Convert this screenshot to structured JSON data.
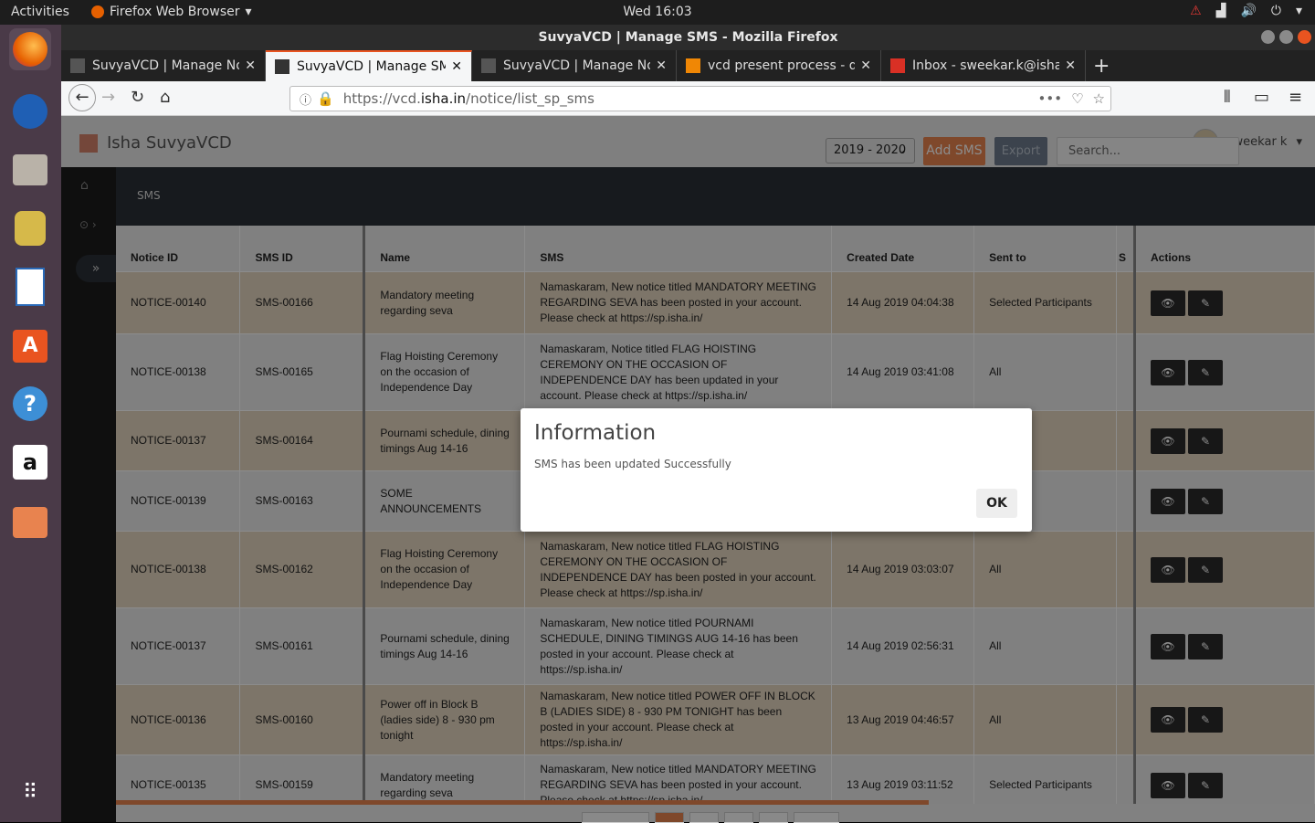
{
  "topbar": {
    "activities": "Activities",
    "app_name": "Firefox Web Browser",
    "clock": "Wed 16:03"
  },
  "window": {
    "title": "SuvyaVCD | Manage SMS - Mozilla Firefox"
  },
  "tabs": [
    {
      "label": "SuvyaVCD | Manage Noti"
    },
    {
      "label": "SuvyaVCD | Manage SMS"
    },
    {
      "label": "SuvyaVCD | Manage Noti"
    },
    {
      "label": "vcd present process - dra"
    },
    {
      "label": "Inbox - sweekar.k@ishaf"
    }
  ],
  "url": {
    "prefix": "https://vcd.",
    "domain": "isha.in",
    "path": "/notice/list_sp_sms"
  },
  "app": {
    "brand": "Isha SuvyaVCD",
    "user": "sweekar k",
    "breadcrumb": "SMS",
    "year": "2019 - 2020",
    "add_sms": "Add SMS",
    "export": "Export",
    "search_placeholder": "Search..."
  },
  "table": {
    "headers": [
      "Notice ID",
      "SMS ID",
      "Name",
      "SMS",
      "Created Date",
      "Sent to",
      "S",
      "Actions"
    ],
    "rows": [
      {
        "notice_id": "NOTICE-00140",
        "sms_id": "SMS-00166",
        "name": "Mandatory meeting regarding seva",
        "sms": "Namaskaram, New notice titled MANDATORY MEETING REGARDING SEVA has been posted in your account. Please check at https://sp.isha.in/",
        "created": "14 Aug 2019 04:04:38",
        "sent_to": "Selected Participants"
      },
      {
        "notice_id": "NOTICE-00138",
        "sms_id": "SMS-00165",
        "name": "Flag Hoisting Ceremony on the occasion of Independence Day",
        "sms": "Namaskaram, Notice titled FLAG HOISTING CEREMONY ON THE OCCASION OF INDEPENDENCE DAY has been updated in your account. Please check at https://sp.isha.in/",
        "created": "14 Aug 2019 03:41:08",
        "sent_to": "All"
      },
      {
        "notice_id": "NOTICE-00137",
        "sms_id": "SMS-00164",
        "name": "Pournami schedule, dining timings Aug 14-16",
        "sms": "",
        "created": "",
        "sent_to": ""
      },
      {
        "notice_id": "NOTICE-00139",
        "sms_id": "SMS-00163",
        "name": "SOME ANNOUNCEMENTS",
        "sms": "",
        "created": "",
        "sent_to": ""
      },
      {
        "notice_id": "NOTICE-00138",
        "sms_id": "SMS-00162",
        "name": "Flag Hoisting Ceremony on the occasion of Independence Day",
        "sms": "Namaskaram, New notice titled FLAG HOISTING CEREMONY ON THE OCCASION OF INDEPENDENCE DAY has been posted in your account. Please check at https://sp.isha.in/",
        "created": "14 Aug 2019 03:03:07",
        "sent_to": "All"
      },
      {
        "notice_id": "NOTICE-00137",
        "sms_id": "SMS-00161",
        "name": "Pournami schedule, dining timings Aug 14-16",
        "sms": "Namaskaram, New notice titled POURNAMI SCHEDULE, DINING TIMINGS AUG 14-16 has been posted in your account. Please check at https://sp.isha.in/",
        "created": "14 Aug 2019 02:56:31",
        "sent_to": "All"
      },
      {
        "notice_id": "NOTICE-00136",
        "sms_id": "SMS-00160",
        "name": "Power off in Block B (ladies side) 8 - 930 pm tonight",
        "sms": "Namaskaram, New notice titled POWER OFF IN BLOCK B (LADIES SIDE) 8 - 930 PM TONIGHT has been posted in your account. Please check at https://sp.isha.in/",
        "created": "13 Aug 2019 04:46:57",
        "sent_to": "All"
      },
      {
        "notice_id": "NOTICE-00135",
        "sms_id": "SMS-00159",
        "name": "Mandatory meeting regarding seva",
        "sms": "Namaskaram, New notice titled MANDATORY MEETING REGARDING SEVA has been posted in your account. Please check at https://sp.isha.in/",
        "created": "13 Aug 2019 03:11:52",
        "sent_to": "Selected Participants"
      }
    ]
  },
  "dialog": {
    "title": "Information",
    "message": "SMS has been updated Successfully",
    "ok": "OK"
  },
  "colors": {
    "accent": "#e8834f",
    "row_odd": "#e4d6c0",
    "row_even": "#e9e9e9",
    "ubuntu_orange": "#e95420"
  }
}
